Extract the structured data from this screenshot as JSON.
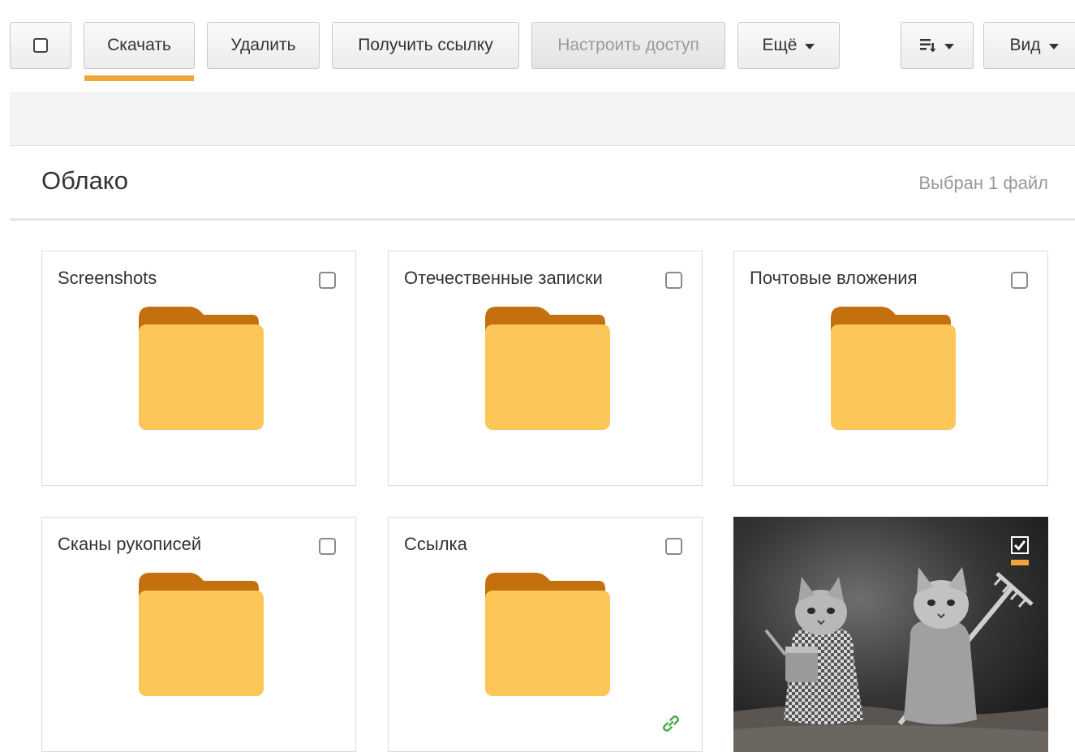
{
  "toolbar": {
    "download_label": "Скачать",
    "delete_label": "Удалить",
    "get_link_label": "Получить ссылку",
    "configure_access_label": "Настроить доступ",
    "more_label": "Ещё",
    "view_label": "Вид"
  },
  "header": {
    "title": "Облако",
    "selection_status": "Выбран 1 файл"
  },
  "tiles": [
    {
      "name": "Screenshots",
      "type": "folder",
      "checked": false
    },
    {
      "name": "Отечественные записки",
      "type": "folder",
      "checked": false
    },
    {
      "name": "Почтовые вложения",
      "type": "folder",
      "checked": false
    },
    {
      "name": "Сканы рукописей",
      "type": "folder",
      "checked": false
    },
    {
      "name": "Ссылка",
      "type": "folder",
      "checked": false,
      "shared_link": true
    },
    {
      "type": "image",
      "checked": true
    }
  ],
  "icons": {
    "folder": "folder-icon",
    "sort": "sort-icon",
    "link": "link-icon",
    "checkbox_checked": "checkbox-checked-icon"
  },
  "colors": {
    "accent": "#f0a43a",
    "folder_body": "#fcc659",
    "folder_tab": "#c4700e",
    "link_green": "#4caf50",
    "status_gray": "#999999"
  }
}
